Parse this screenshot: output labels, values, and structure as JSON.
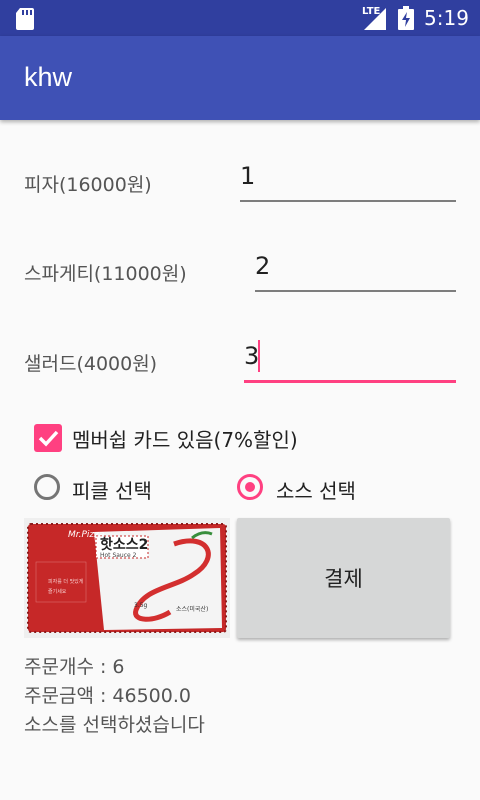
{
  "status_bar": {
    "time": "5:19",
    "network": "LTE",
    "icons": [
      "sd-card-icon",
      "signal-icon",
      "battery-icon"
    ]
  },
  "app_bar": {
    "title": "khw"
  },
  "menu": [
    {
      "label": "피자(16000원)",
      "quantity": "1"
    },
    {
      "label": "스파게티(11000원)",
      "quantity": "2"
    },
    {
      "label": "샐러드(4000원)",
      "quantity": "3"
    }
  ],
  "membership": {
    "label": "멤버쉽 카드 있음(7%할인)",
    "checked": true
  },
  "options": [
    {
      "label": "피클 선택",
      "selected": false
    },
    {
      "label": "소스 선택",
      "selected": true
    }
  ],
  "product_image": {
    "brand": "Mr.Pizza",
    "name_ko": "핫소스2",
    "name_en": "Hot Sauce 2",
    "weight": "3.5g",
    "note_lines": [
      "피자를 더 맛있게",
      "즐기세요"
    ],
    "bottom_right": "소스(미국산)"
  },
  "pay_button": {
    "label": "결제"
  },
  "summary": {
    "count": "주문개수 : 6",
    "amount": "주문금액 : 46500.0",
    "message": "소스를 선택하셨습니다"
  },
  "colors": {
    "primary": "#3f51b5",
    "primary_dark": "#303f9f",
    "accent": "#ff4081"
  }
}
